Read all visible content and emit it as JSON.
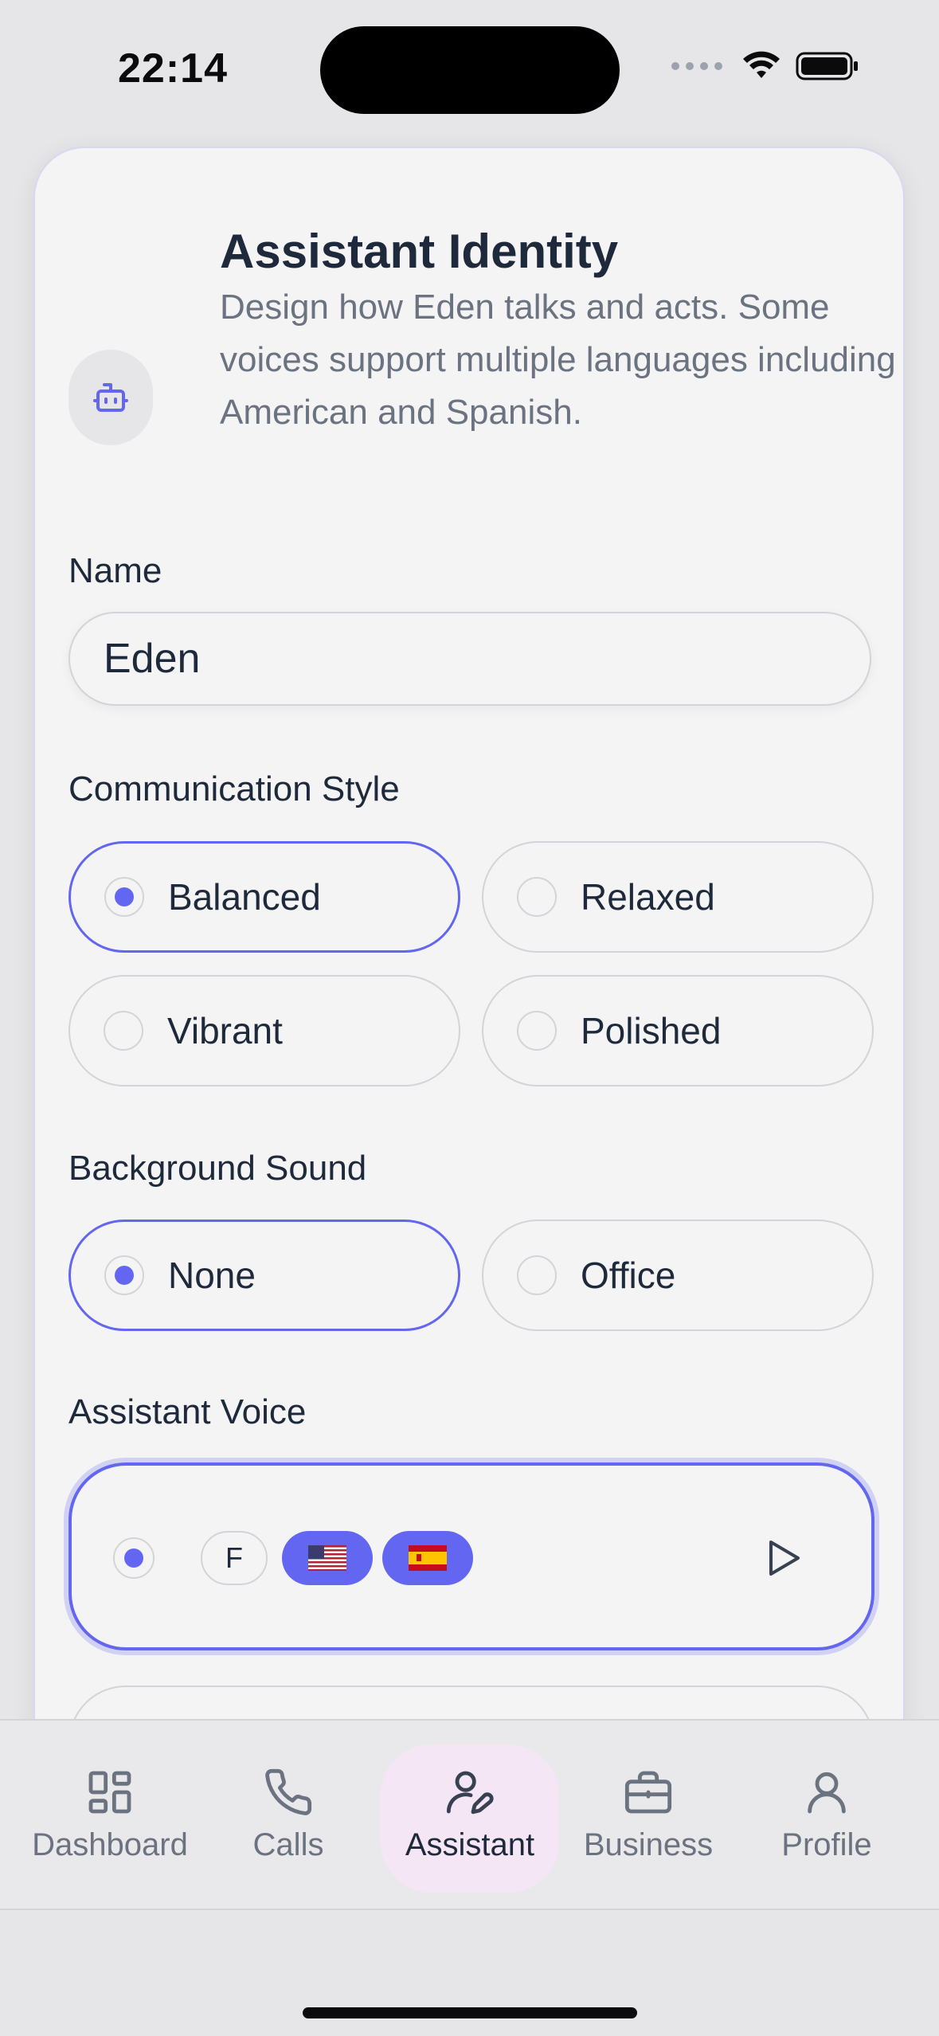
{
  "status_bar": {
    "time": "22:14"
  },
  "header": {
    "title": "Assistant Identity",
    "subtitle": "Design how Eden talks and acts. Some voices support multiple languages including American and Spanish."
  },
  "name_field": {
    "label": "Name",
    "value": "Eden"
  },
  "communication_style": {
    "label": "Communication Style",
    "options": [
      "Balanced",
      "Relaxed",
      "Vibrant",
      "Polished"
    ],
    "selected": "Balanced"
  },
  "background_sound": {
    "label": "Background Sound",
    "options": [
      "None",
      "Office"
    ],
    "selected": "None"
  },
  "assistant_voice": {
    "label": "Assistant Voice",
    "selected_voice": {
      "gender": "F",
      "languages": [
        "🇺🇸",
        "🇪🇸"
      ]
    }
  },
  "tabs": [
    {
      "label": "Dashboard",
      "icon": "grid-icon"
    },
    {
      "label": "Calls",
      "icon": "phone-icon"
    },
    {
      "label": "Assistant",
      "icon": "user-edit-icon",
      "active": true
    },
    {
      "label": "Business",
      "icon": "briefcase-icon"
    },
    {
      "label": "Profile",
      "icon": "person-icon"
    }
  ],
  "colors": {
    "accent": "#6366f1",
    "active_tab_bg": "#f5e6f5",
    "text": "#1e2a3b",
    "muted": "#6b7280"
  }
}
